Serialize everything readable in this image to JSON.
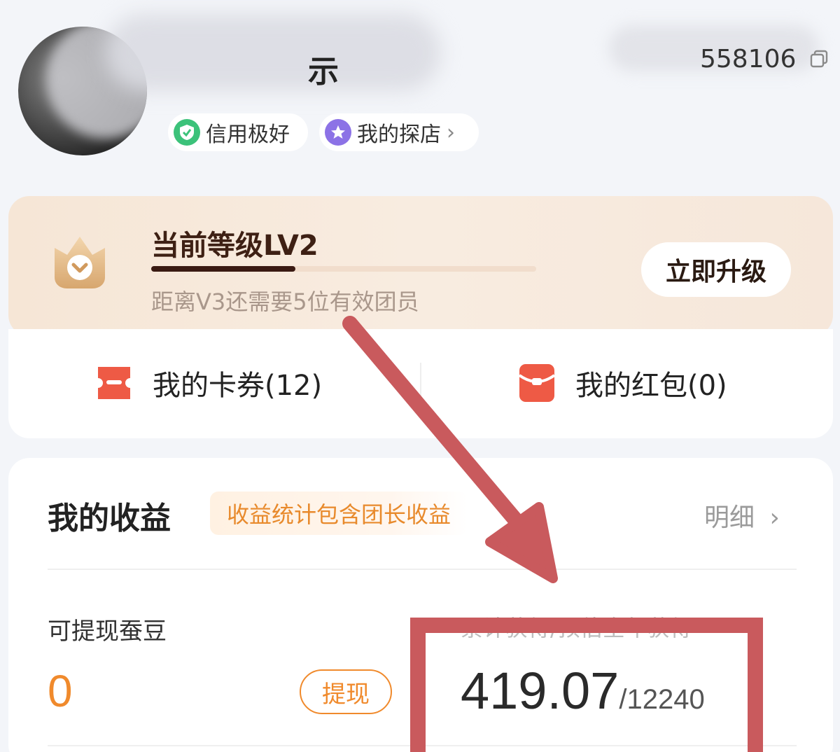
{
  "header": {
    "name_visible": "示",
    "id_visible": "558106",
    "badges": [
      {
        "label": "信用极好",
        "icon": "shield-check-icon"
      },
      {
        "label": "我的探店",
        "icon": "star-icon"
      }
    ]
  },
  "level": {
    "title": "当前等级LV2",
    "progress": 0.375,
    "subtitle": "距离V3还需要5位有效团员",
    "upgrade_label": "立即升级"
  },
  "coupons": {
    "cards_label": "我的卡券(12)",
    "redpack_label": "我的红包(0)"
  },
  "earnings": {
    "title": "我的收益",
    "tag": "收益统计包含团长收益",
    "detail_label": "明细",
    "withdrawable_label": "可提现蚕豆",
    "withdrawable_value": "0",
    "withdraw_button": "提现",
    "total_label": "累计获得/预估全年获得",
    "total_value": "419.07",
    "total_annual": "/12240"
  },
  "colors": {
    "accent_orange": "#f08a2c",
    "annotation_red": "#c95a5d",
    "level_bg": "#f6e6d6"
  }
}
